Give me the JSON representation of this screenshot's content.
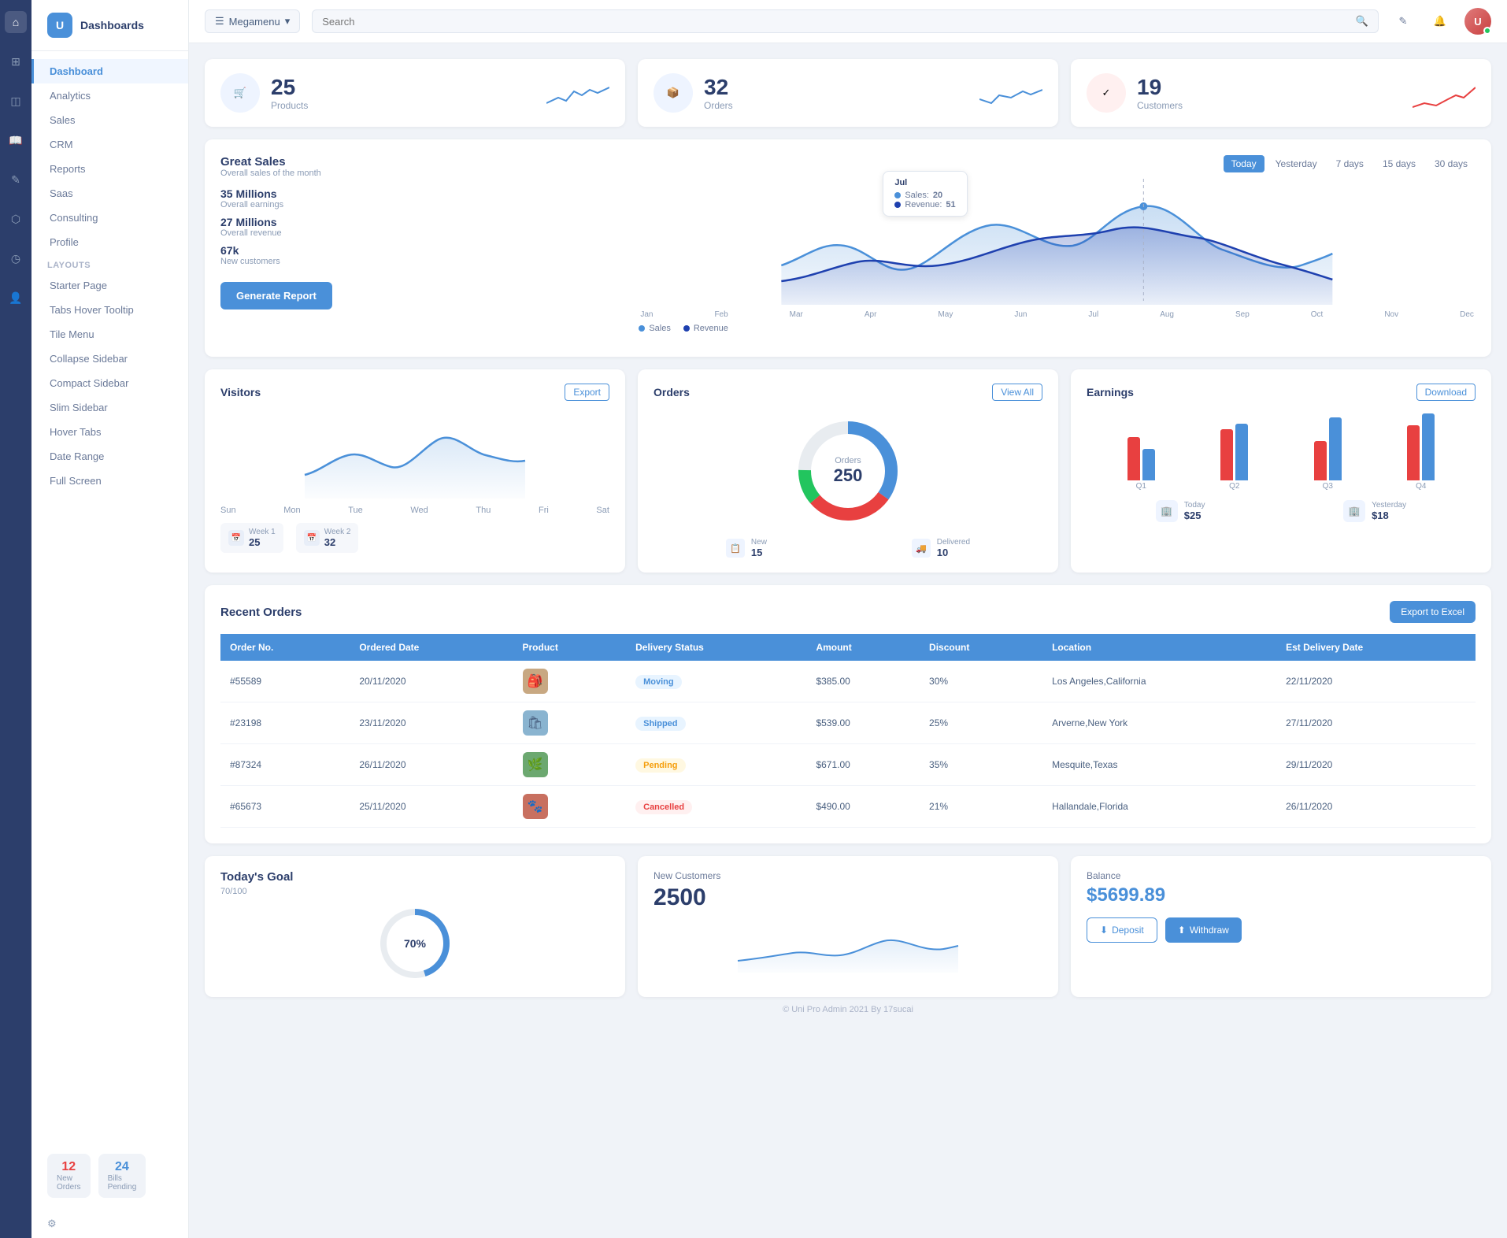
{
  "app": {
    "title": "Dashboards",
    "logo_letter": "U"
  },
  "sidebar": {
    "nav_items": [
      {
        "label": "Dashboard",
        "active": true
      },
      {
        "label": "Analytics"
      },
      {
        "label": "Sales"
      },
      {
        "label": "CRM"
      },
      {
        "label": "Reports"
      },
      {
        "label": "Saas"
      },
      {
        "label": "Consulting"
      },
      {
        "label": "Profile"
      }
    ],
    "layouts_label": "LAYOUTS",
    "layout_items": [
      {
        "label": "Starter Page"
      },
      {
        "label": "Tabs Hover Tooltip"
      },
      {
        "label": "Tile Menu"
      },
      {
        "label": "Collapse Sidebar"
      },
      {
        "label": "Compact Sidebar"
      },
      {
        "label": "Slim Sidebar"
      },
      {
        "label": "Hover Tabs"
      },
      {
        "label": "Date Range"
      },
      {
        "label": "Full Screen"
      }
    ],
    "badges": [
      {
        "num": "12",
        "label": "New\nOrders",
        "color": "red"
      },
      {
        "num": "24",
        "label": "Bills\nPending",
        "color": "blue"
      }
    ]
  },
  "topbar": {
    "megamenu_label": "Megamenu",
    "search_placeholder": "Search"
  },
  "stats": [
    {
      "num": "25",
      "label": "Products",
      "icon": "🛒"
    },
    {
      "num": "32",
      "label": "Orders",
      "icon": "📦"
    },
    {
      "num": "19",
      "label": "Customers",
      "icon": "✓"
    }
  ],
  "sales_chart": {
    "title": "Great Sales",
    "subtitle": "Overall sales of the month",
    "metrics": [
      {
        "num": "35 Millions",
        "label": "Overall earnings"
      },
      {
        "num": "27 Millions",
        "label": "Overall revenue"
      },
      {
        "num": "67k",
        "label": "New customers"
      }
    ],
    "time_tabs": [
      "Today",
      "Yesterday",
      "7 days",
      "15 days",
      "30 days"
    ],
    "active_tab": "Today",
    "tooltip": {
      "date": "Jul",
      "sales": 20,
      "revenue": 51
    },
    "legend": [
      {
        "label": "Sales",
        "color": "#4a90d9"
      },
      {
        "label": "Revenue",
        "color": "#2563eb"
      }
    ],
    "generate_btn": "Generate Report",
    "x_labels": [
      "Jan",
      "Feb",
      "Mar",
      "Apr",
      "May",
      "Jun",
      "Jul",
      "Aug",
      "Sep",
      "Oct",
      "Nov",
      "Dec"
    ]
  },
  "visitors": {
    "title": "Visitors",
    "export_btn": "Export",
    "x_labels": [
      "Sun",
      "Mon",
      "Tue",
      "Wed",
      "Thu",
      "Fri",
      "Sat"
    ],
    "weeks": [
      {
        "label": "Week 1",
        "num": "25"
      },
      {
        "label": "Week 2",
        "num": "32"
      }
    ]
  },
  "orders": {
    "title": "Orders",
    "view_all_btn": "View All",
    "donut_label": "Orders",
    "donut_num": "250",
    "stats": [
      {
        "label": "New",
        "num": "15"
      },
      {
        "label": "Delivered",
        "num": "10"
      }
    ]
  },
  "earnings": {
    "title": "Earnings",
    "download_btn": "Download",
    "bars": [
      {
        "q": "Q1",
        "red": 55,
        "blue": 40
      },
      {
        "q": "Q2",
        "red": 65,
        "blue": 70
      },
      {
        "q": "Q3",
        "red": 50,
        "blue": 80
      },
      {
        "q": "Q4",
        "red": 70,
        "blue": 85
      }
    ],
    "footer": [
      {
        "label": "Today",
        "val": "$25"
      },
      {
        "label": "Yesterday",
        "val": "$18"
      }
    ]
  },
  "recent_orders": {
    "title": "Recent Orders",
    "export_btn": "Export to Excel",
    "headers": [
      "Order No.",
      "Ordered Date",
      "Product",
      "Delivery Status",
      "Amount",
      "Discount",
      "Location",
      "Est Delivery Date"
    ],
    "rows": [
      {
        "order": "#55589",
        "date": "20/11/2020",
        "status": "Moving",
        "amount": "$385.00",
        "discount": "30%",
        "location": "Los Angeles,California",
        "delivery": "22/11/2020",
        "status_class": "status-moving"
      },
      {
        "order": "#23198",
        "date": "23/11/2020",
        "status": "Shipped",
        "amount": "$539.00",
        "discount": "25%",
        "location": "Arverne,New York",
        "delivery": "27/11/2020",
        "status_class": "status-shipped"
      },
      {
        "order": "#87324",
        "date": "26/11/2020",
        "status": "Pending",
        "amount": "$671.00",
        "discount": "35%",
        "location": "Mesquite,Texas",
        "delivery": "29/11/2020",
        "status_class": "status-pending"
      },
      {
        "order": "#65673",
        "date": "25/11/2020",
        "status": "Cancelled",
        "amount": "$490.00",
        "discount": "21%",
        "location": "Hallandale,Florida",
        "delivery": "26/11/2020",
        "status_class": "status-cancelled"
      }
    ]
  },
  "todays_goal": {
    "title": "Today's Goal",
    "subtitle": "70/100",
    "percent": 70
  },
  "new_customers": {
    "label": "New Customers",
    "num": "2500"
  },
  "balance": {
    "label": "Balance",
    "amount": "$5699.89",
    "deposit_btn": "Deposit",
    "withdraw_btn": "Withdraw"
  },
  "footer": {
    "text": "© Uni Pro Admin 2021 By 17sucai"
  }
}
